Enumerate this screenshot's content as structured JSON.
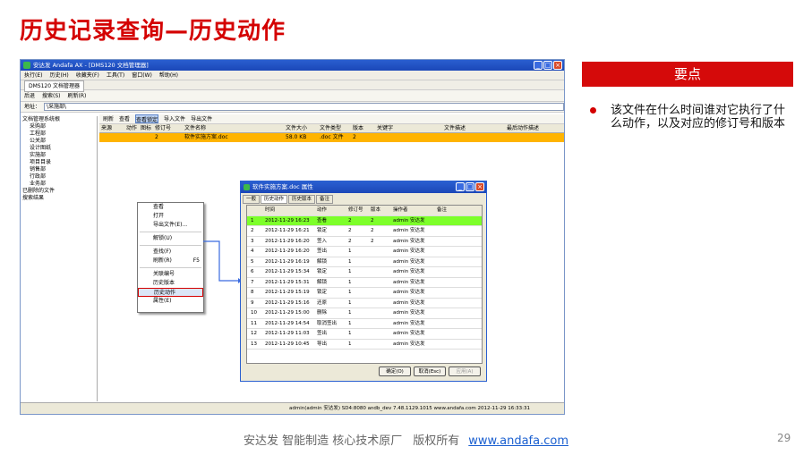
{
  "slide": {
    "title": "历史记录查询—历史动作",
    "key_title": "要点",
    "bullet": "该文件在什么时间谁对它执行了什么动作，以及对应的修订号和版本",
    "footer_text": "安达发  智能制造 核心技术原厂",
    "footer_rights": "版权所有",
    "footer_link": "www.andafa.com",
    "page_number": "29"
  },
  "app": {
    "title": "安达发 Andafa AX - [DMS120 文档管理器]",
    "menu": [
      "执行(E)",
      "历史(H)",
      "收藏夹(F)",
      "工具(T)",
      "窗口(W)",
      "帮助(H)"
    ],
    "doc_tab": "DMS120 文档管理器",
    "toolbar": [
      "后退",
      "搜索(S)",
      "刷新(R)"
    ],
    "address_label": "地址：",
    "address_value": "\\采施部\\",
    "tree": [
      "文档管理系统根",
      "采购部",
      "工程部",
      "公关部",
      "设计图纸",
      "实施部",
      "项目目录",
      "销售部",
      "行政部",
      "业务部",
      "已删除的文件",
      "搜索结果"
    ],
    "sub_toolbar": [
      "刷新",
      "查看",
      "查看锁定",
      "导入文件",
      "导出文件"
    ],
    "columns": [
      "来源",
      "动作",
      "图标",
      "修订号",
      "文件名称",
      "文件大小",
      "文件类型",
      "版本",
      "关键字",
      "文件描述",
      "最后动作描述"
    ],
    "file_row": {
      "rev": "2",
      "name": "软件实施方案.doc",
      "size": "58.0 KB",
      "type": ".doc 文件",
      "version": "2"
    },
    "context_menu": [
      "查看",
      "打开",
      "导出文件(E)...",
      "解锁(U)",
      "查找(F)",
      "刷新(R)",
      "F5",
      "关联编号",
      "历史版本",
      "历史动作",
      "属性(E)"
    ],
    "status": "admin(admin 安达发)  SD4:8080  andb_dev  7.48.1129.1015  www.andafa.com  2012-11-29 16:33:31"
  },
  "dialog": {
    "title": "软件实施方案.doc 属性",
    "tabs": [
      "一般",
      "历史动作",
      "历史版本",
      "备注"
    ],
    "columns": [
      "时间",
      "动作",
      "修订号",
      "版本",
      "操作者",
      "备注"
    ],
    "rows": [
      {
        "n": "1",
        "time": "2012-11-29 16:23",
        "action": "查看",
        "rev": "2",
        "ver": "2",
        "user": "admin 安达发"
      },
      {
        "n": "2",
        "time": "2012-11-29 16:21",
        "action": "锁定",
        "rev": "2",
        "ver": "2",
        "user": "admin 安达发"
      },
      {
        "n": "3",
        "time": "2012-11-29 16:20",
        "action": "签入",
        "rev": "2",
        "ver": "2",
        "user": "admin 安达发"
      },
      {
        "n": "4",
        "time": "2012-11-29 16:20",
        "action": "签出",
        "rev": "1",
        "ver": "",
        "user": "admin 安达发"
      },
      {
        "n": "5",
        "time": "2012-11-29 16:19",
        "action": "解锁",
        "rev": "1",
        "ver": "",
        "user": "admin 安达发"
      },
      {
        "n": "6",
        "time": "2012-11-29 15:34",
        "action": "锁定",
        "rev": "1",
        "ver": "",
        "user": "admin 安达发"
      },
      {
        "n": "7",
        "time": "2012-11-29 15:31",
        "action": "解锁",
        "rev": "1",
        "ver": "",
        "user": "admin 安达发"
      },
      {
        "n": "8",
        "time": "2012-11-29 15:19",
        "action": "锁定",
        "rev": "1",
        "ver": "",
        "user": "admin 安达发"
      },
      {
        "n": "9",
        "time": "2012-11-29 15:16",
        "action": "还原",
        "rev": "1",
        "ver": "",
        "user": "admin 安达发"
      },
      {
        "n": "10",
        "time": "2012-11-29 15:00",
        "action": "删除",
        "rev": "1",
        "ver": "",
        "user": "admin 安达发"
      },
      {
        "n": "11",
        "time": "2012-11-29 14:54",
        "action": "取消签出",
        "rev": "1",
        "ver": "",
        "user": "admin 安达发"
      },
      {
        "n": "12",
        "time": "2012-11-29 11:03",
        "action": "签出",
        "rev": "1",
        "ver": "",
        "user": "admin 安达发"
      },
      {
        "n": "13",
        "time": "2012-11-29 10:45",
        "action": "导出",
        "rev": "1",
        "ver": "",
        "user": "admin 安达发"
      }
    ],
    "buttons": [
      "确定(O)",
      "取消(Esc)",
      "应用(A)"
    ]
  }
}
